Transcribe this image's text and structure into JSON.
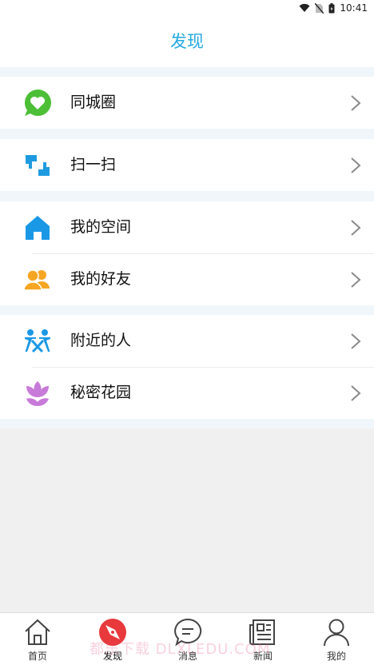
{
  "status_bar": {
    "time": "10:41"
  },
  "header": {
    "title": "发现"
  },
  "menu": {
    "moments": "同城圈",
    "scan": "扫一扫",
    "my_space": "我的空间",
    "my_friends": "我的好友",
    "nearby": "附近的人",
    "secret_garden": "秘密花园"
  },
  "tabbar": {
    "home": "首页",
    "discover": "发现",
    "messages": "消息",
    "news": "新闻",
    "mine": "我的"
  },
  "watermark": "都乐下载 DLXLEDU.COM",
  "colors": {
    "accent": "#23a9e1",
    "moments_green": "#4cbf36",
    "scan_blue": "#1e9be0",
    "space_blue": "#1a98e6",
    "friends_orange": "#f6a623",
    "nearby_blue": "#1a98e6",
    "garden_purple": "#c87ad9",
    "discover_red": "#e8393d"
  }
}
